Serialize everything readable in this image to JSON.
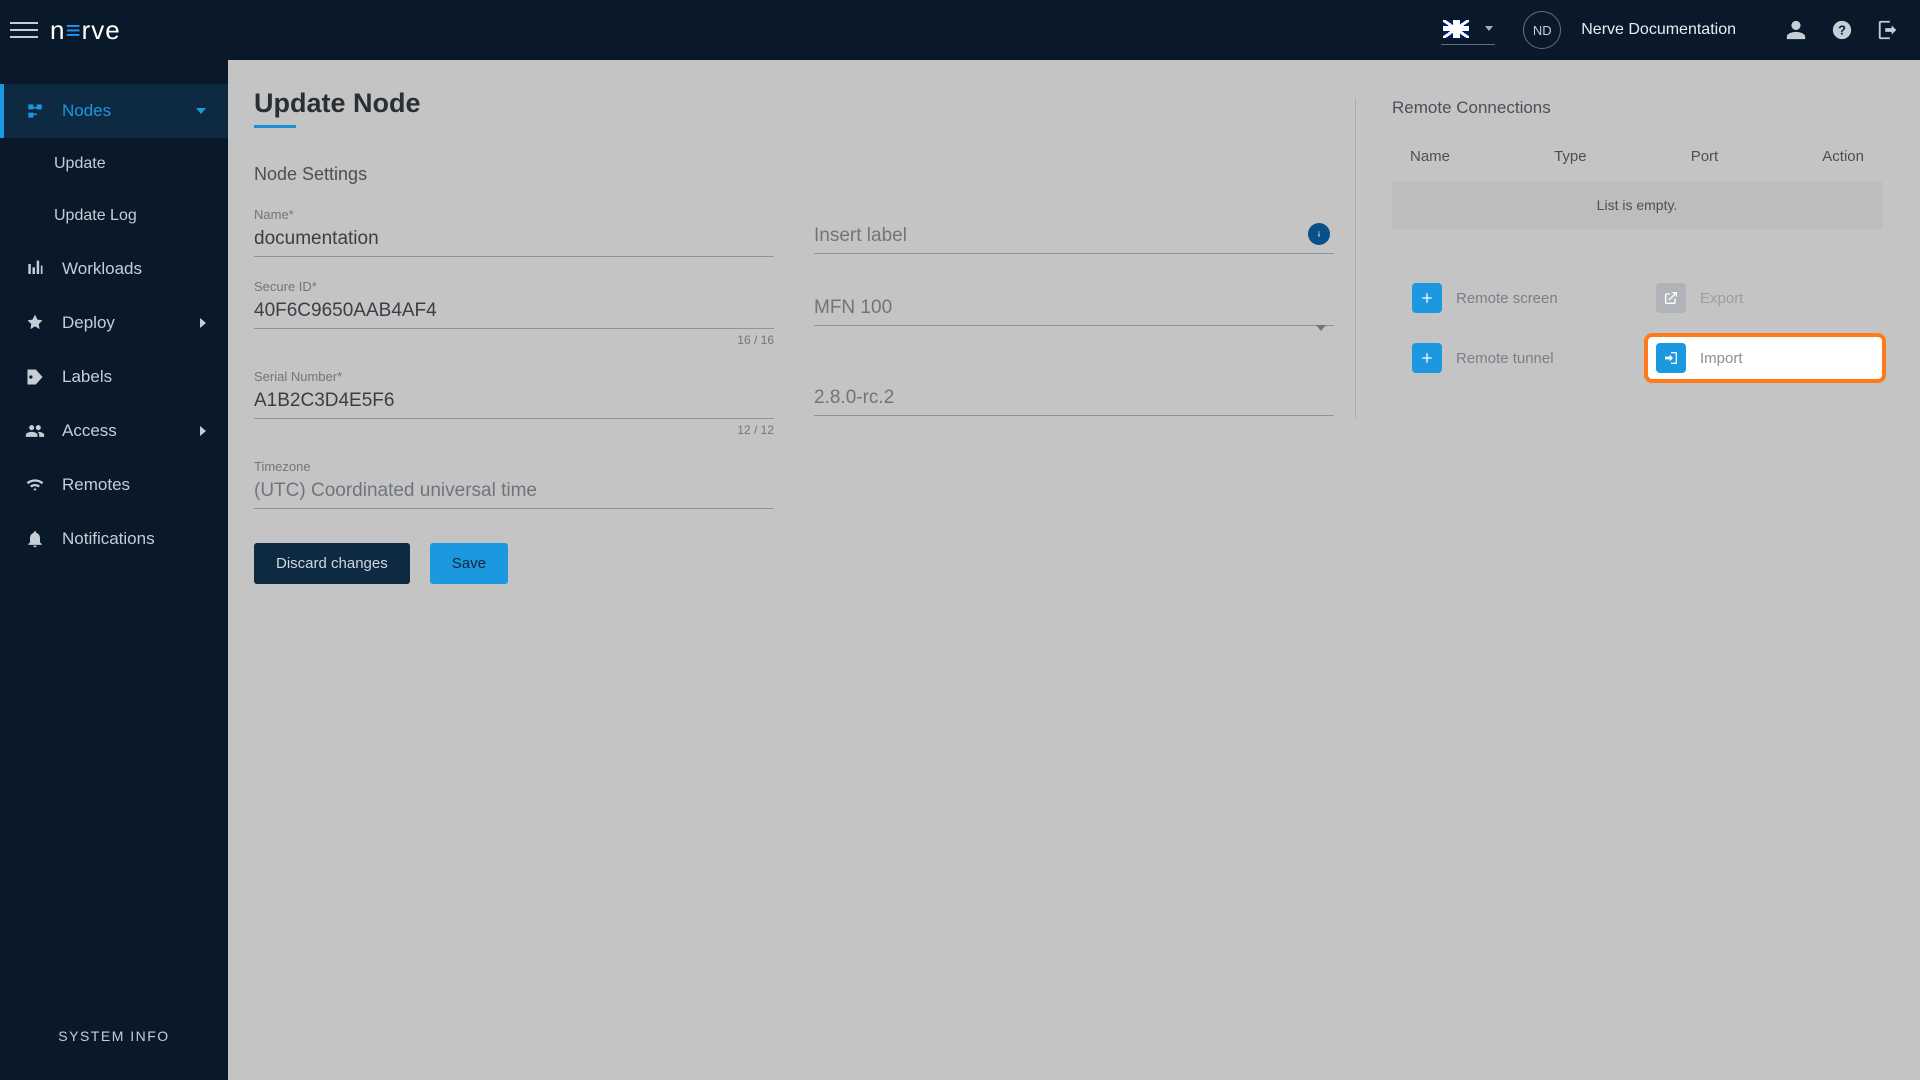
{
  "header": {
    "avatar_initials": "ND",
    "username": "Nerve Documentation"
  },
  "sidebar": {
    "nodes": "Nodes",
    "update": "Update",
    "update_log": "Update Log",
    "workloads": "Workloads",
    "deploy": "Deploy",
    "labels": "Labels",
    "access": "Access",
    "remotes": "Remotes",
    "notifications": "Notifications",
    "system_info": "SYSTEM INFO"
  },
  "page": {
    "title": "Update Node",
    "section": "Node Settings"
  },
  "form": {
    "name_label": "Name*",
    "name_value": "documentation",
    "label_placeholder": "Insert label",
    "secure_id_label": "Secure ID*",
    "secure_id_value": "40F6C9650AAB4AF4",
    "secure_id_count": "16 / 16",
    "model_value": "MFN 100",
    "serial_label": "Serial Number*",
    "serial_value": "A1B2C3D4E5F6",
    "serial_count": "12 / 12",
    "version_value": "2.8.0-rc.2",
    "timezone_label": "Timezone",
    "timezone_value": "(UTC) Coordinated universal time",
    "discard": "Discard changes",
    "save": "Save"
  },
  "remote": {
    "title": "Remote Connections",
    "col_name": "Name",
    "col_type": "Type",
    "col_port": "Port",
    "col_action": "Action",
    "empty": "List is empty.",
    "remote_screen": "Remote screen",
    "export": "Export",
    "remote_tunnel": "Remote tunnel",
    "import": "Import"
  }
}
